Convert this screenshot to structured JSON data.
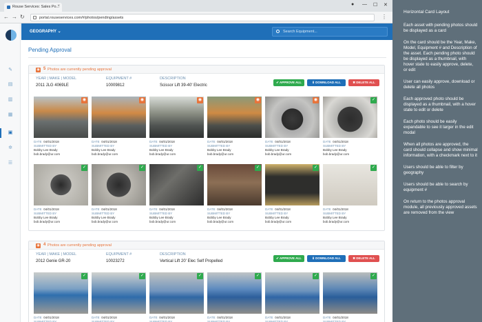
{
  "browser": {
    "tab_title": "Rouse Services: Sales Po...",
    "url": "portal.rouseservices.com/#/photos/pending/assets"
  },
  "app": {
    "geography_label": "GEOGRAPHY",
    "search_placeholder": "Search Equipment...",
    "page_title": "Pending Approval"
  },
  "labels": {
    "ymm": "YEAR | MAKE | MODEL",
    "equipment": "EQUIPMENT #",
    "description": "DESCRIPTION",
    "approve_all": "✔ APPROVE ALL",
    "download_all": "⬇ DOWNLOAD ALL",
    "delete_all": "✖ DELETE ALL",
    "date": "DATE",
    "submitted_by": "SUBMITTED BY"
  },
  "cards": [
    {
      "count": "5",
      "pending_text": "Photos are currently pending approval",
      "ymm": "2011 JLG 4069LE",
      "equipment": "10009812",
      "description": "Scissor Lift 39-40' Electric",
      "photos": [
        {
          "date": "04/01/2018",
          "name": "Bobby Lee Brady",
          "email": "bob.brady@ur.com",
          "status": "pending"
        },
        {
          "date": "04/01/2018",
          "name": "Bobby Lee Brady",
          "email": "bob.brady@ur.com",
          "status": "pending"
        },
        {
          "date": "04/01/2018",
          "name": "Bobby Lee Brady",
          "email": "bob.brady@ur.com",
          "status": "pending"
        },
        {
          "date": "04/01/2018",
          "name": "Bobby Lee Brady",
          "email": "bob.brady@ur.com",
          "status": "pending"
        },
        {
          "date": "04/01/2018",
          "name": "Bobby Lee Brady",
          "email": "bob.brady@ur.com",
          "status": "pending"
        },
        {
          "date": "04/01/2018",
          "name": "Bobby Lee Brady",
          "email": "bob.brady@ur.com",
          "status": "approved"
        },
        {
          "date": "04/01/2018",
          "name": "Bobby Lee Brady",
          "email": "bob.brady@ur.com",
          "status": "approved"
        },
        {
          "date": "04/01/2018",
          "name": "Bobby Lee Brady",
          "email": "bob.brady@ur.com",
          "status": "approved"
        },
        {
          "date": "04/01/2018",
          "name": "Bobby Lee Brady",
          "email": "bob.brady@ur.com",
          "status": "approved"
        },
        {
          "date": "04/01/2018",
          "name": "Bobby Lee Brady",
          "email": "bob.brady@ur.com",
          "status": "approved"
        },
        {
          "date": "04/01/2018",
          "name": "Bobby Lee Brady",
          "email": "bob.brady@ur.com",
          "status": "approved"
        },
        {
          "date": "04/01/2018",
          "name": "Bobby Lee Brady",
          "email": "bob.brady@ur.com",
          "status": "approved"
        }
      ]
    },
    {
      "count": "4",
      "pending_text": "Photos are currently pending approval",
      "ymm": "2012 Genie GR-20",
      "equipment": "10023272",
      "description": "Vertical Lift 20' Elec Self Propelled",
      "photos": [
        {
          "date": "04/01/2018",
          "status": "approved"
        },
        {
          "date": "04/01/2018",
          "status": "approved"
        },
        {
          "date": "04/01/2018",
          "status": "approved"
        },
        {
          "date": "04/01/2018",
          "status": "approved"
        },
        {
          "date": "04/01/2018",
          "status": "approved"
        },
        {
          "date": "04/01/2018",
          "status": "approved"
        }
      ]
    }
  ],
  "notes": {
    "title": "Horizontal Card Layout",
    "items": [
      "Each asset with pending photos should be displayed as a card",
      "On the card should be the Year, Make, Model, Equipment # and Description of the asset. Each pending photo should be displayed as a thumbnail, with hover state to easily approve, delete, or edit",
      "User can easily approve, download or delete all photos",
      "Each approved photo should be displayed as a thumbnail, with a hover state to edit or delete",
      "Each photo should be easily expandable to see it larger in the edit modal",
      "When all photos are approved, the card should collapse and show minimal information, with a checkmark next to it",
      "Users should be able to filter by geography",
      "Users should be able to search by equipment #",
      "On return to the photos approval module, all previously approved assets are removed from the view"
    ]
  }
}
